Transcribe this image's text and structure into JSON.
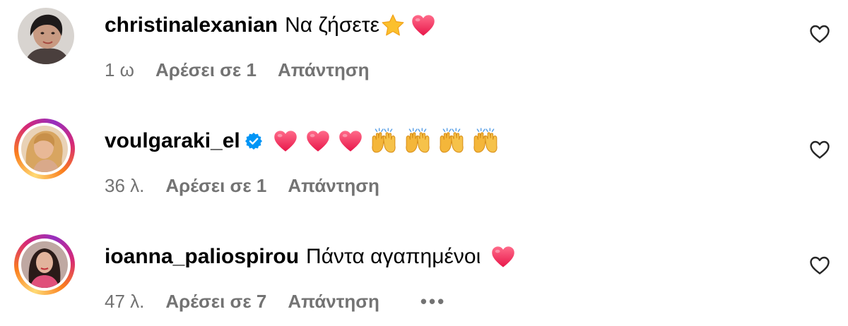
{
  "comments": [
    {
      "username": "christinalexanian",
      "text": "Να ζήσετε",
      "time": "1 ω",
      "likes": "Αρέσει σε 1",
      "reply": "Απάντηση",
      "emojis": [
        "star-icon",
        "heart-emoji-icon"
      ]
    },
    {
      "username": "voulgaraki_el",
      "verified": true,
      "text": "",
      "time": "36 λ.",
      "likes": "Αρέσει σε 1",
      "reply": "Απάντηση",
      "emojis": [
        "heart-emoji-icon",
        "heart-emoji-icon",
        "heart-emoji-icon",
        "raising-hands-icon",
        "raising-hands-icon",
        "raising-hands-icon",
        "raising-hands-icon"
      ]
    },
    {
      "username": "ioanna_paliospirou",
      "text": "Πάντα αγαπημένοι",
      "time": "47 λ.",
      "likes": "Αρέσει σε 7",
      "reply": "Απάντηση",
      "more": "•••",
      "emojis": [
        "heart-emoji-icon"
      ]
    }
  ],
  "colors": {
    "meta_text": "#737373",
    "verified_blue": "#0095f6",
    "heart_emoji": "#f23a5e",
    "star_emoji": "#fbc02d",
    "hands_emoji": "#f4b63a"
  }
}
